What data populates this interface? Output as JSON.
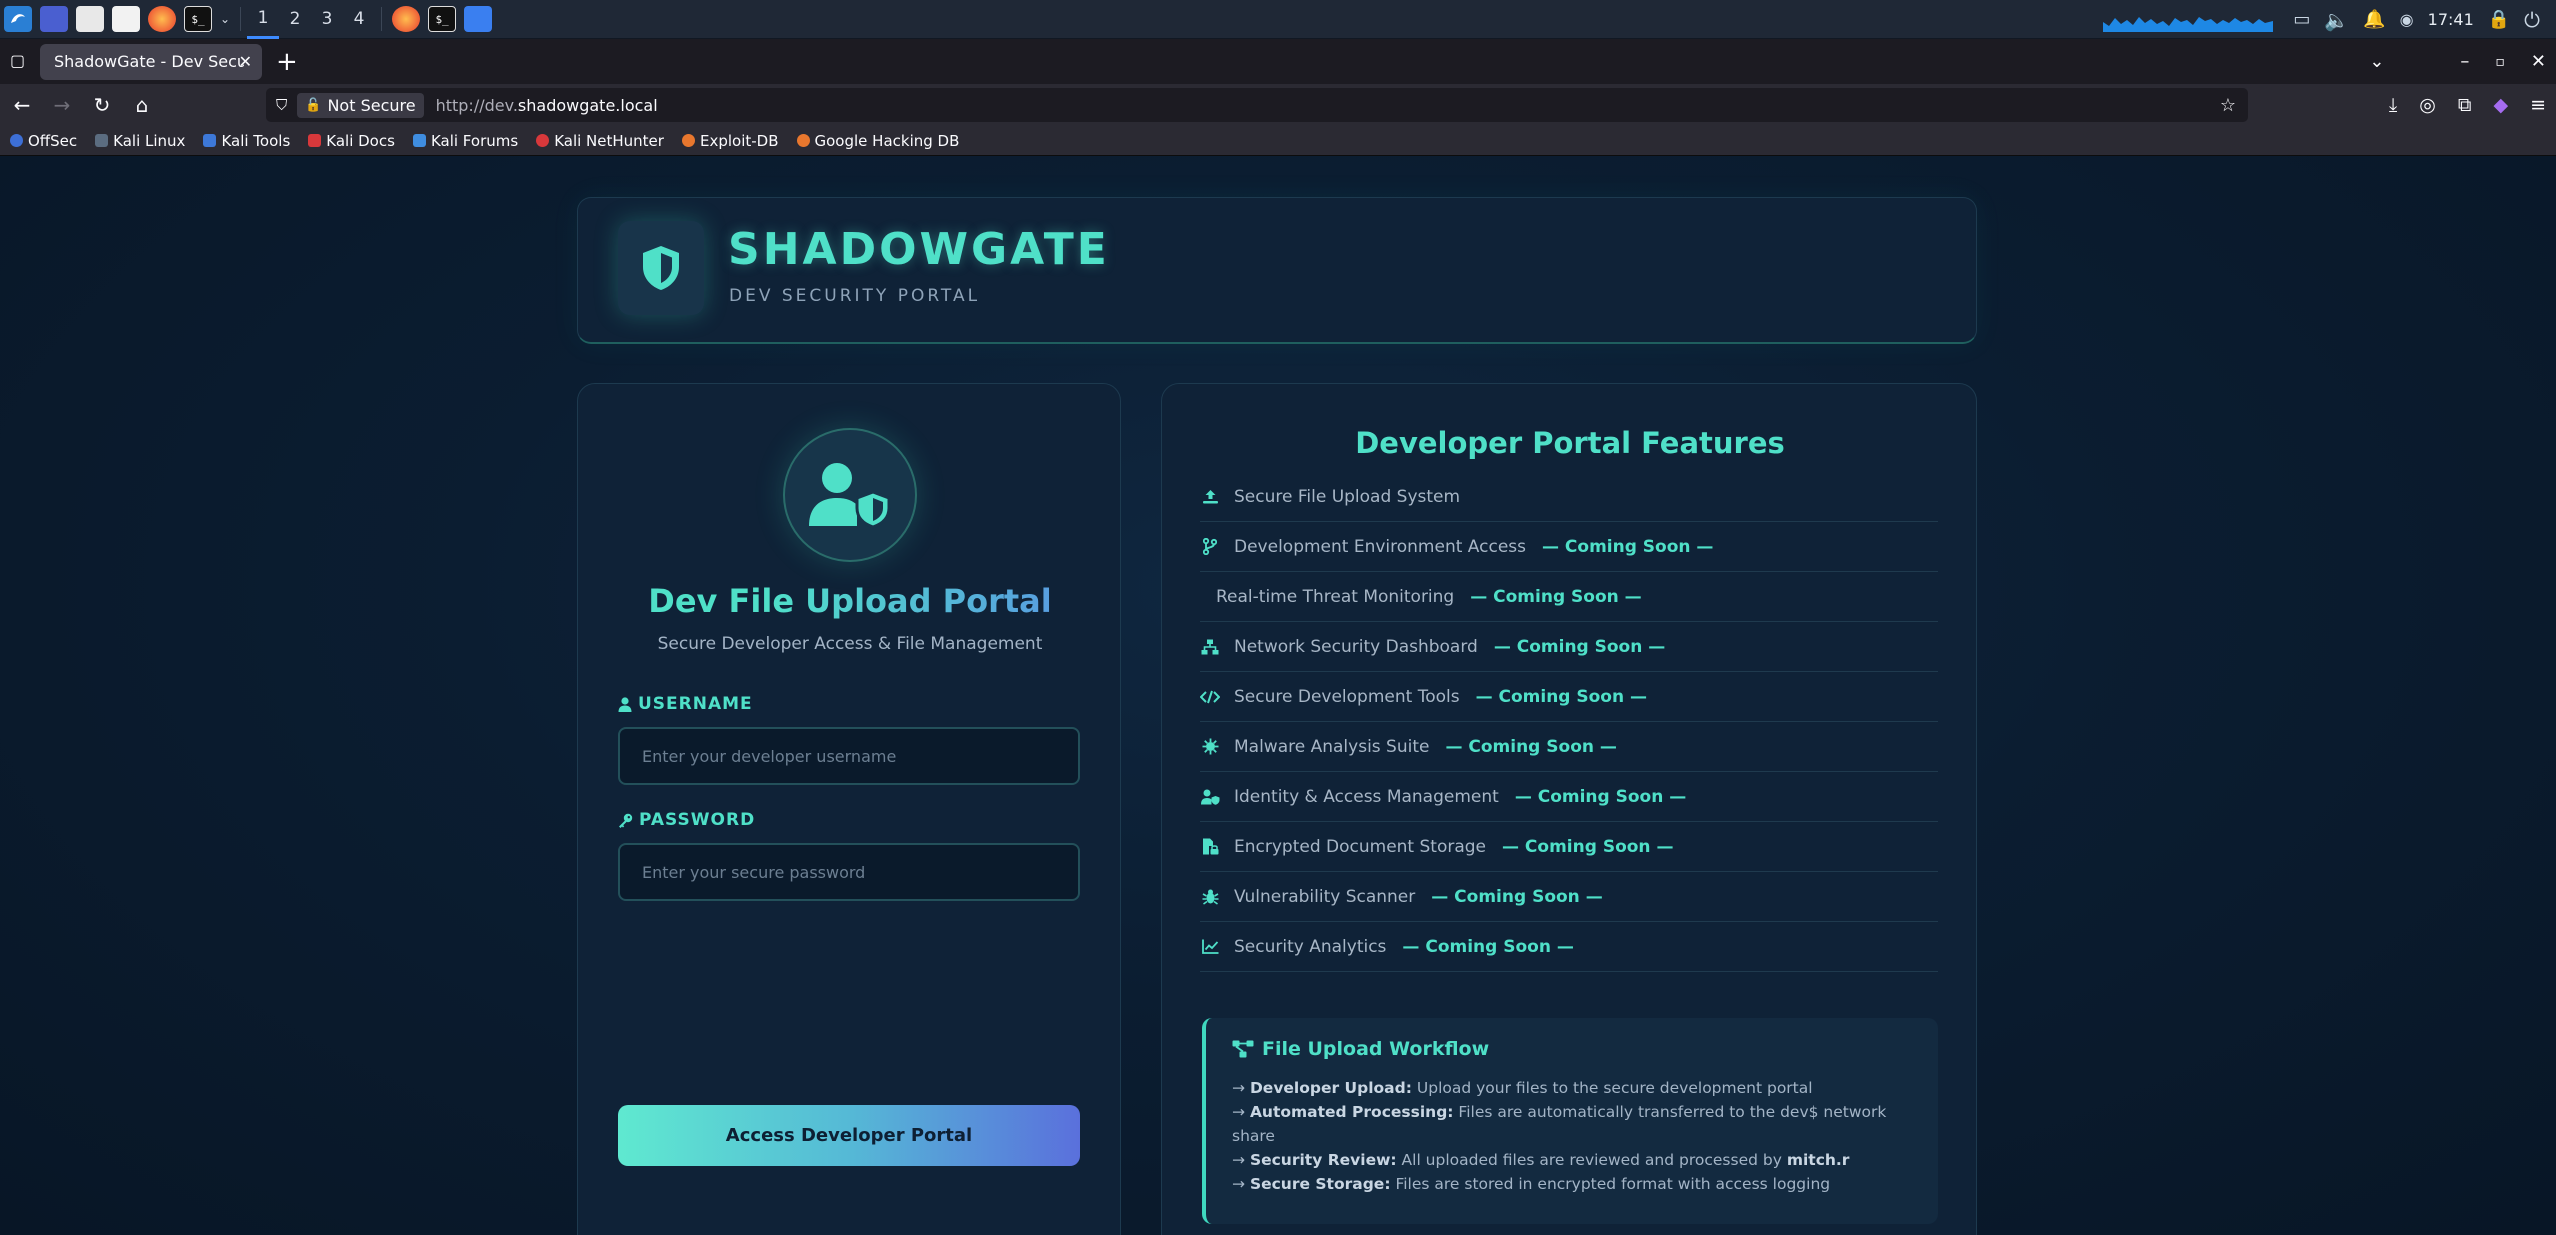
{
  "taskbar": {
    "workspaces": [
      "1",
      "2",
      "3",
      "4"
    ],
    "clock": "17:41"
  },
  "browser": {
    "tab_title": "ShadowGate - Dev Security Portal",
    "security_label": "Not Secure",
    "url_prefix": "http://dev.",
    "url_domain": "shadowgate.local",
    "bookmarks": [
      "OffSec",
      "Kali Linux",
      "Kali Tools",
      "Kali Docs",
      "Kali Forums",
      "Kali NetHunter",
      "Exploit-DB",
      "Google Hacking DB"
    ]
  },
  "header": {
    "brand": "SHADOWGATE",
    "subtitle": "DEV SECURITY PORTAL"
  },
  "login": {
    "title": "Dev File Upload Portal",
    "subtitle": "Secure Developer Access & File Management",
    "username_label": "USERNAME",
    "username_placeholder": "Enter your developer username",
    "password_label": "PASSWORD",
    "password_placeholder": "Enter your secure password",
    "submit_label": "Access Developer Portal"
  },
  "features": {
    "title": "Developer Portal Features",
    "items": [
      {
        "label": "Secure File Upload System",
        "status": "",
        "icon": "upload-icon"
      },
      {
        "label": "Development Environment Access",
        "status": "— Coming Soon —",
        "icon": "branch-icon"
      },
      {
        "label": "Real-time Threat Monitoring",
        "status": "— Coming Soon —",
        "icon": ""
      },
      {
        "label": "Network Security Dashboard",
        "status": "— Coming Soon —",
        "icon": "network-icon"
      },
      {
        "label": "Secure Development Tools",
        "status": "— Coming Soon —",
        "icon": "code-icon"
      },
      {
        "label": "Malware Analysis Suite",
        "status": "— Coming Soon —",
        "icon": "virus-icon"
      },
      {
        "label": "Identity & Access Management",
        "status": "— Coming Soon —",
        "icon": "user-shield-icon"
      },
      {
        "label": "Encrypted Document Storage",
        "status": "— Coming Soon —",
        "icon": "file-lock-icon"
      },
      {
        "label": "Vulnerability Scanner",
        "status": "— Coming Soon —",
        "icon": "bug-icon"
      },
      {
        "label": "Security Analytics",
        "status": "— Coming Soon —",
        "icon": "chart-icon"
      }
    ]
  },
  "workflow": {
    "title": "File Upload Workflow",
    "lines": [
      {
        "arrow": "→",
        "key": "Developer Upload:",
        "text": " Upload your files to the secure development portal",
        "tail": ""
      },
      {
        "arrow": "→",
        "key": "Automated Processing:",
        "text": " Files are automatically transferred to the dev$ network share",
        "tail": ""
      },
      {
        "arrow": "→",
        "key": "Security Review:",
        "text": " All uploaded files are reviewed and processed by ",
        "tail": "mitch.r"
      },
      {
        "arrow": "→",
        "key": "Secure Storage:",
        "text": " Files are stored in encrypted format with access logging",
        "tail": ""
      }
    ]
  },
  "colors": {
    "accent": "#4fe0c8",
    "accent_blue": "#5a70dc",
    "card_bg": "#0f2237",
    "page_bg": "#0b1d31"
  }
}
